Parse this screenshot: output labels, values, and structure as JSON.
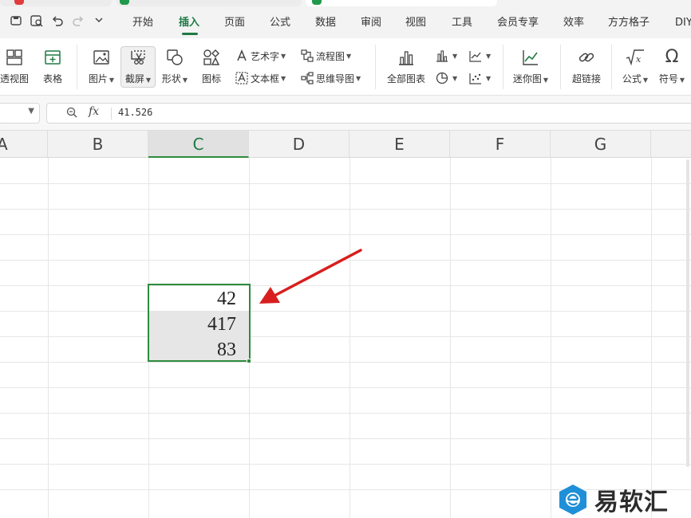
{
  "menu": {
    "items": [
      "开始",
      "插入",
      "页面",
      "公式",
      "数据",
      "审阅",
      "视图",
      "工具",
      "会员专享",
      "效率",
      "方方格子",
      "DIY"
    ],
    "active": "插入"
  },
  "ribbon": {
    "pivot_view": "透视图",
    "table": "表格",
    "picture": "图片",
    "screenshot": "截屏",
    "shape": "形状",
    "icon": "图标",
    "word_art": "艺术字",
    "text_box": "文本框",
    "flowchart": "流程图",
    "mind_map": "思维导图",
    "all_charts": "全部图表",
    "sparkline": "迷你图",
    "hyperlink": "超链接",
    "formula": "公式",
    "symbol": "符号"
  },
  "formula_bar": {
    "value": "41.526",
    "fx": "fx"
  },
  "sheet": {
    "columns": [
      "A",
      "B",
      "C",
      "D",
      "E",
      "F",
      "G"
    ],
    "selected_column": "C",
    "cells": [
      "42",
      "417",
      "83"
    ]
  },
  "watermark": {
    "text": "易软汇"
  },
  "colors": {
    "accent_green": "#2e8b3d",
    "arrow_red": "#d81e1e",
    "watermark_blue": "#1f8fd8"
  }
}
